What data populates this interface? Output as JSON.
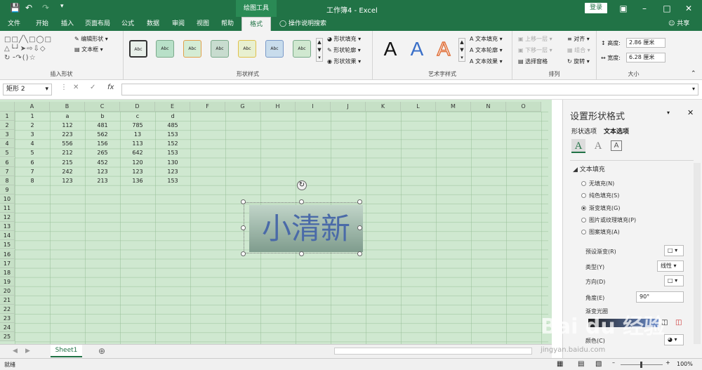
{
  "title_bar": {
    "tool_tab": "绘图工具",
    "window_title": "工作簿4 - Excel",
    "login": "登录"
  },
  "tabs": [
    "文件",
    "开始",
    "插入",
    "页面布局",
    "公式",
    "数据",
    "审阅",
    "视图",
    "帮助",
    "格式"
  ],
  "tell_me": "操作说明搜索",
  "share": "共享",
  "ribbon": {
    "insert_shapes": {
      "label": "插入形状",
      "edit_shape": "编辑形状",
      "text_box": "文本框"
    },
    "shape_styles": {
      "label": "形状样式",
      "swatch": "Abc",
      "fill": "形状填充",
      "outline": "形状轮廓",
      "effects": "形状效果"
    },
    "wordart": {
      "label": "艺术字样式",
      "glyph": "A",
      "text_fill": "文本填充",
      "text_outline": "文本轮廓",
      "text_effects": "文本效果"
    },
    "arrange": {
      "label": "排列",
      "bring_forward": "上移一层",
      "send_backward": "下移一层",
      "selection_pane": "选择窗格",
      "align": "对齐",
      "group": "组合",
      "rotate": "旋转"
    },
    "size": {
      "label": "大小",
      "height_label": "高度:",
      "height": "2.86 厘米",
      "width_label": "宽度:",
      "width": "6.28 厘米"
    }
  },
  "formula_bar": {
    "name_box": "矩形 2",
    "fx": "fx"
  },
  "columns": [
    "A",
    "B",
    "C",
    "D",
    "E",
    "F",
    "G",
    "H",
    "I",
    "J",
    "K",
    "L",
    "M",
    "N",
    "O"
  ],
  "rows": [
    "1",
    "2",
    "3",
    "4",
    "5",
    "6",
    "7",
    "8",
    "9",
    "10",
    "11",
    "12",
    "13",
    "14",
    "15",
    "16",
    "17",
    "18",
    "19",
    "20",
    "21",
    "22",
    "23",
    "24",
    "25"
  ],
  "table": [
    [
      "1",
      "a",
      "b",
      "c",
      "d"
    ],
    [
      "2",
      "112",
      "481",
      "785",
      "485"
    ],
    [
      "3",
      "223",
      "562",
      "13",
      "153"
    ],
    [
      "4",
      "556",
      "156",
      "113",
      "152"
    ],
    [
      "5",
      "212",
      "265",
      "642",
      "153"
    ],
    [
      "6",
      "215",
      "452",
      "120",
      "130"
    ],
    [
      "7",
      "242",
      "123",
      "123",
      "123"
    ],
    [
      "8",
      "123",
      "213",
      "136",
      "153"
    ]
  ],
  "shape_text": "小清新",
  "sheet_tab": "Sheet1",
  "status": {
    "ready": "就绪",
    "zoom": "100%"
  },
  "panel": {
    "title": "设置形状格式",
    "tab_shape": "形状选项",
    "tab_text": "文本选项",
    "section": "文本填充",
    "options": [
      "无填充(N)",
      "纯色填充(S)",
      "渐变填充(G)",
      "图片或纹理填充(P)",
      "图案填充(A)"
    ],
    "selected_index": 2,
    "preset": "预设渐变(R)",
    "type_label": "类型(Y)",
    "type_value": "线性",
    "direction": "方向(D)",
    "angle_label": "角度(E)",
    "angle_value": "90°",
    "stops": "渐变光圈",
    "color": "颜色(C)"
  },
  "watermark": {
    "brand": "Bai du 经验",
    "url": "jingyan.baidu.com"
  }
}
